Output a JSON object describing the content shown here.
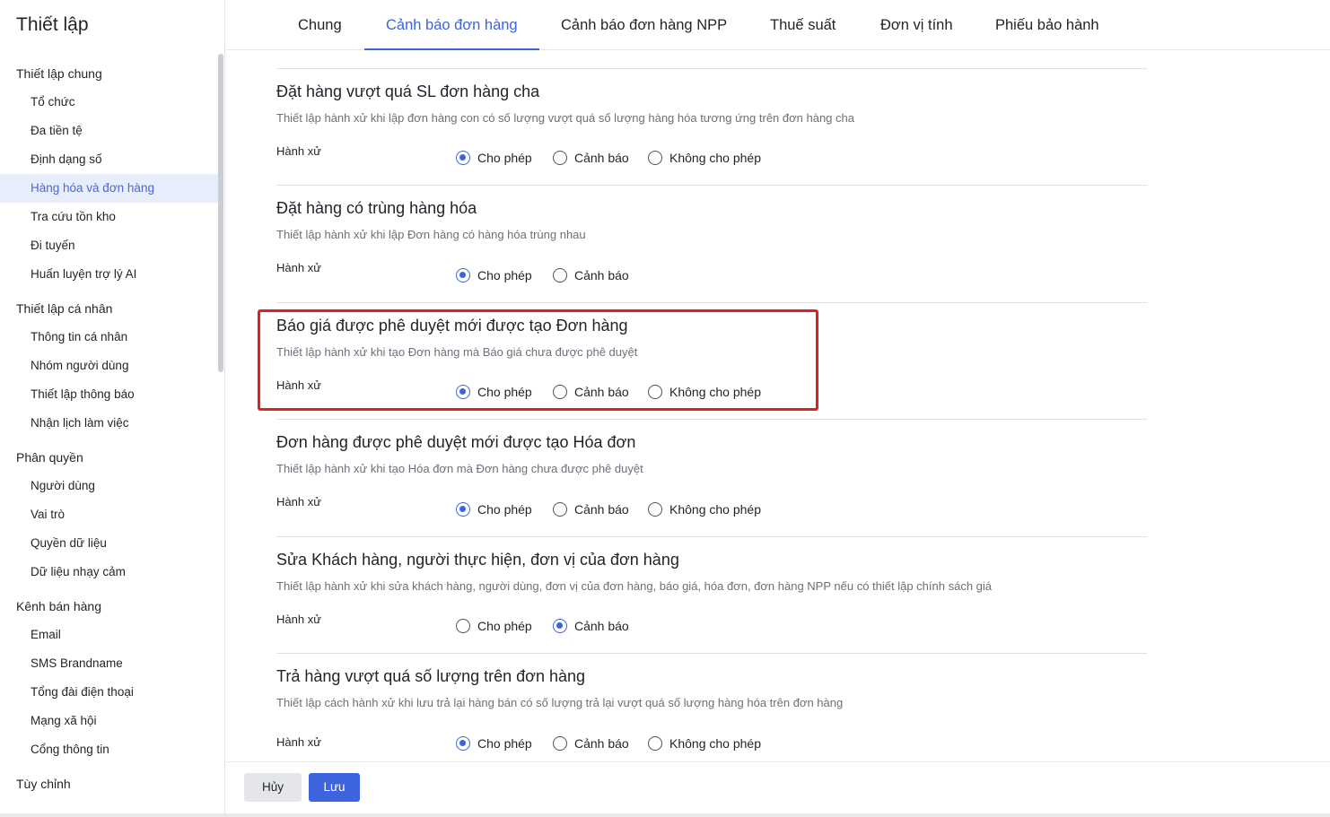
{
  "sidebar": {
    "title": "Thiết lập",
    "groups": [
      {
        "label": "Thiết lập chung",
        "items": [
          "Tổ chức",
          "Đa tiền tệ",
          "Định dạng số",
          "Hàng hóa và đơn hàng",
          "Tra cứu tồn kho",
          "Đi tuyến",
          "Huấn luyện trợ lý AI"
        ]
      },
      {
        "label": "Thiết lập cá nhân",
        "items": [
          "Thông tin cá nhân",
          "Nhóm người dùng",
          "Thiết lập thông báo",
          "Nhận lịch làm việc"
        ]
      },
      {
        "label": "Phân quyền",
        "items": [
          "Người dùng",
          "Vai trò",
          "Quyền dữ liệu",
          "Dữ liệu nhạy cảm"
        ]
      },
      {
        "label": "Kênh bán hàng",
        "items": [
          "Email",
          "SMS Brandname",
          "Tổng đài điện thoại",
          "Mạng xã hội",
          "Cổng thông tin"
        ]
      },
      {
        "label": "Tùy chỉnh",
        "items": []
      }
    ],
    "active_item": "Hàng hóa và đơn hàng"
  },
  "tabs": [
    {
      "label": "Chung",
      "active": false
    },
    {
      "label": "Cảnh báo đơn hàng",
      "active": true
    },
    {
      "label": "Cảnh báo đơn hàng NPP",
      "active": false
    },
    {
      "label": "Thuế suất",
      "active": false
    },
    {
      "label": "Đơn vị tính",
      "active": false
    },
    {
      "label": "Phiếu bảo hành",
      "active": false
    }
  ],
  "options_labels": {
    "allow": "Cho phép",
    "warn": "Cảnh báo",
    "deny": "Không cho phép"
  },
  "sections": [
    {
      "title": "Đặt hàng vượt quá SL đơn hàng cha",
      "description": "Thiết lập hành xử khi lập đơn hàng con có số lượng vượt quá số lượng hàng hóa tương ứng trên đơn hàng cha",
      "label": "Hành xử",
      "options": [
        "Cho phép",
        "Cảnh báo",
        "Không cho phép"
      ],
      "selected": "Cho phép"
    },
    {
      "title": "Đặt hàng có trùng hàng hóa",
      "description": "Thiết lập hành xử khi lập Đơn hàng có hàng hóa trùng nhau",
      "label": "Hành xử",
      "options": [
        "Cho phép",
        "Cảnh báo"
      ],
      "selected": "Cho phép"
    },
    {
      "title": "Báo giá được phê duyệt mới được tạo Đơn hàng",
      "description": "Thiết lập hành xử khi tạo Đơn hàng mà Báo giá chưa được phê duyệt",
      "label": "Hành xử",
      "options": [
        "Cho phép",
        "Cảnh báo",
        "Không cho phép"
      ],
      "selected": "Cho phép"
    },
    {
      "title": "Đơn hàng được phê duyệt mới được tạo Hóa đơn",
      "description": "Thiết lập hành xử khi tạo Hóa đơn mà Đơn hàng chưa được phê duyệt",
      "label": "Hành xử",
      "options": [
        "Cho phép",
        "Cảnh báo",
        "Không cho phép"
      ],
      "selected": "Cho phép"
    },
    {
      "title": "Sửa Khách hàng, người thực hiện, đơn vị của đơn hàng",
      "description": "Thiết lập hành xử khi sửa khách hàng, người dùng, đơn vị của đơn hàng, báo giá, hóa đơn, đơn hàng NPP nếu có thiết lập chính sách giá",
      "label": "Hành xử",
      "options": [
        "Cho phép",
        "Cảnh báo"
      ],
      "selected": "Cảnh báo"
    },
    {
      "title": "Trả hàng vượt quá số lượng trên đơn hàng",
      "description": "Thiết lập cách hành xử khi lưu trả lại hàng bán có số lượng trả lại vượt quá số lượng hàng hóa trên đơn hàng",
      "label": "Hành xử",
      "options": [
        "Cho phép",
        "Cảnh báo",
        "Không cho phép"
      ],
      "selected": "Cho phép"
    }
  ],
  "footer": {
    "cancel_label": "Hủy",
    "save_label": "Lưu"
  },
  "colors": {
    "accent": "#3d63dd",
    "highlight": "#e02020",
    "active_bg": "#e8edfb"
  }
}
